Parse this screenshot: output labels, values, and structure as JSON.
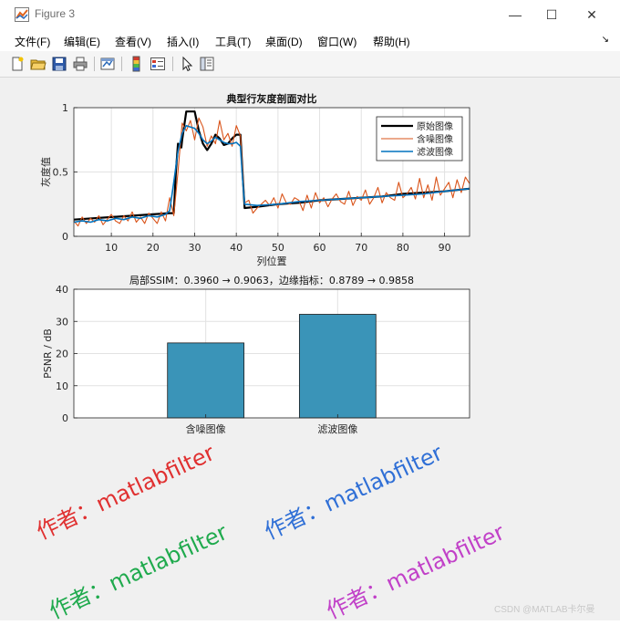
{
  "window": {
    "title": "Figure 3",
    "controls": [
      "—",
      "☐",
      "✕"
    ]
  },
  "menu": [
    {
      "label": "文件(F)"
    },
    {
      "label": "编辑(E)"
    },
    {
      "label": "查看(V)"
    },
    {
      "label": "插入(I)"
    },
    {
      "label": "工具(T)"
    },
    {
      "label": "桌面(D)"
    },
    {
      "label": "窗口(W)"
    },
    {
      "label": "帮助(H)"
    }
  ],
  "menu_arrow": "↘",
  "toolbar_icons": [
    "new-figure-icon",
    "open-file-icon",
    "save-icon",
    "print-icon",
    "link-icon",
    "colorbar-icon",
    "legend-icon",
    "pointer-icon",
    "property-editor-icon"
  ],
  "chart_data": [
    {
      "type": "line",
      "title": "典型行灰度剖面对比",
      "xlabel": "列位置",
      "ylabel": "灰度值",
      "xlim": [
        1,
        96
      ],
      "ylim": [
        0,
        1
      ],
      "xticks": [
        10,
        20,
        30,
        40,
        50,
        60,
        70,
        80,
        90
      ],
      "yticks": [
        0,
        0.5,
        1
      ],
      "grid": true,
      "legend_position": "top-right",
      "series": [
        {
          "name": "原始图像",
          "color": "#000000",
          "x": [
            1,
            24,
            25,
            25.5,
            26,
            26.8,
            27,
            28,
            29,
            30,
            31,
            32,
            33,
            34,
            35,
            36,
            37,
            38,
            39,
            40,
            41,
            41.5,
            42,
            45,
            50,
            55,
            60,
            65,
            70,
            75,
            80,
            85,
            90,
            96
          ],
          "y": [
            0.13,
            0.18,
            0.18,
            0.5,
            0.72,
            0.69,
            0.75,
            0.97,
            0.97,
            0.97,
            0.82,
            0.72,
            0.67,
            0.72,
            0.79,
            0.76,
            0.71,
            0.72,
            0.76,
            0.79,
            0.79,
            0.5,
            0.22,
            0.23,
            0.25,
            0.26,
            0.28,
            0.29,
            0.3,
            0.31,
            0.33,
            0.34,
            0.35,
            0.37
          ]
        },
        {
          "name": "含噪图像",
          "color": "#d95319",
          "x": [
            1,
            2,
            3,
            4,
            5,
            6,
            7,
            8,
            9,
            10,
            11,
            12,
            13,
            14,
            15,
            16,
            17,
            18,
            19,
            20,
            21,
            22,
            23,
            24,
            25,
            26,
            27,
            28,
            29,
            30,
            31,
            32,
            33,
            34,
            35,
            36,
            37,
            38,
            39,
            40,
            41,
            42,
            43,
            44,
            45,
            46,
            47,
            48,
            49,
            50,
            51,
            52,
            53,
            54,
            55,
            56,
            57,
            58,
            59,
            60,
            61,
            62,
            63,
            64,
            65,
            66,
            67,
            68,
            69,
            70,
            71,
            72,
            73,
            74,
            75,
            76,
            77,
            78,
            79,
            80,
            81,
            82,
            83,
            84,
            85,
            86,
            87,
            88,
            89,
            90,
            91,
            92,
            93,
            94,
            95,
            96
          ],
          "y": [
            0.12,
            0.08,
            0.15,
            0.1,
            0.14,
            0.11,
            0.16,
            0.09,
            0.13,
            0.17,
            0.12,
            0.1,
            0.16,
            0.12,
            0.19,
            0.11,
            0.15,
            0.1,
            0.18,
            0.14,
            0.1,
            0.19,
            0.12,
            0.3,
            0.16,
            0.5,
            0.88,
            0.82,
            0.9,
            0.75,
            0.92,
            0.85,
            0.7,
            0.78,
            0.72,
            0.9,
            0.75,
            0.8,
            0.7,
            0.86,
            0.78,
            0.26,
            0.28,
            0.18,
            0.22,
            0.25,
            0.28,
            0.24,
            0.3,
            0.22,
            0.33,
            0.26,
            0.25,
            0.3,
            0.28,
            0.2,
            0.32,
            0.22,
            0.34,
            0.26,
            0.3,
            0.23,
            0.29,
            0.33,
            0.27,
            0.25,
            0.35,
            0.24,
            0.31,
            0.28,
            0.36,
            0.25,
            0.3,
            0.38,
            0.26,
            0.34,
            0.3,
            0.28,
            0.42,
            0.3,
            0.33,
            0.38,
            0.29,
            0.45,
            0.3,
            0.4,
            0.28,
            0.46,
            0.32,
            0.37,
            0.42,
            0.3,
            0.44,
            0.34,
            0.46,
            0.41
          ]
        },
        {
          "name": "滤波图像",
          "color": "#0072bd",
          "x": [
            1,
            3,
            5,
            7,
            9,
            11,
            13,
            15,
            17,
            19,
            21,
            23,
            24,
            25,
            26,
            27,
            28,
            29,
            30,
            31,
            32,
            33,
            34,
            35,
            36,
            37,
            38,
            39,
            40,
            41,
            41.5,
            42,
            45,
            50,
            55,
            60,
            65,
            70,
            75,
            80,
            85,
            90,
            96
          ],
          "y": [
            0.11,
            0.12,
            0.11,
            0.13,
            0.12,
            0.14,
            0.13,
            0.15,
            0.14,
            0.16,
            0.15,
            0.17,
            0.2,
            0.42,
            0.66,
            0.8,
            0.86,
            0.85,
            0.84,
            0.8,
            0.75,
            0.72,
            0.74,
            0.77,
            0.75,
            0.73,
            0.72,
            0.72,
            0.73,
            0.7,
            0.45,
            0.25,
            0.24,
            0.25,
            0.27,
            0.28,
            0.29,
            0.3,
            0.31,
            0.32,
            0.33,
            0.35,
            0.37
          ]
        }
      ]
    },
    {
      "type": "bar",
      "title": "局部SSIM：0.3960 → 0.9063，边缘指标：0.8789 → 0.9858",
      "xlabel": "",
      "ylabel": "PSNR / dB",
      "categories": [
        "含噪图像",
        "滤波图像"
      ],
      "values": [
        23.3,
        32.2
      ],
      "color": "#3a94b8",
      "ylim": [
        0,
        40
      ],
      "yticks": [
        0,
        10,
        20,
        30,
        40
      ],
      "grid": true
    }
  ],
  "watermarks": [
    {
      "text": "作者：matlabfilter",
      "color": "#e03030"
    },
    {
      "text": "作者：matlabfilter",
      "color": "#2f6fd6"
    },
    {
      "text": "作者：matlabfilter",
      "color": "#1faa4d"
    },
    {
      "text": "作者：matlabfilter",
      "color": "#c140c8"
    }
  ],
  "credit": "CSDN @MATLAB卡尔曼"
}
